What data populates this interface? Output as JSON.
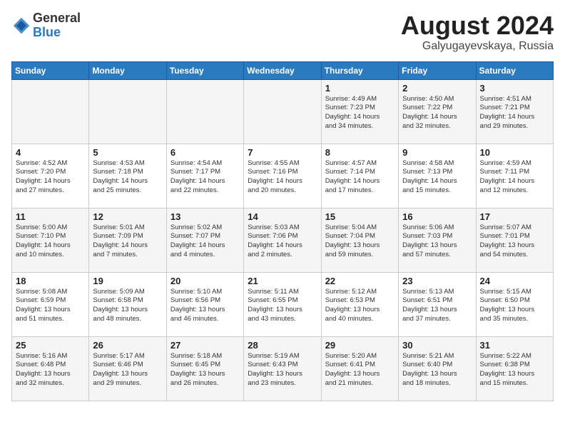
{
  "logo": {
    "general": "General",
    "blue": "Blue"
  },
  "header": {
    "month_year": "August 2024",
    "location": "Galyugayevskaya, Russia"
  },
  "days_of_week": [
    "Sunday",
    "Monday",
    "Tuesday",
    "Wednesday",
    "Thursday",
    "Friday",
    "Saturday"
  ],
  "weeks": [
    [
      {
        "day": "",
        "info": ""
      },
      {
        "day": "",
        "info": ""
      },
      {
        "day": "",
        "info": ""
      },
      {
        "day": "",
        "info": ""
      },
      {
        "day": "1",
        "info": "Sunrise: 4:49 AM\nSunset: 7:23 PM\nDaylight: 14 hours\nand 34 minutes."
      },
      {
        "day": "2",
        "info": "Sunrise: 4:50 AM\nSunset: 7:22 PM\nDaylight: 14 hours\nand 32 minutes."
      },
      {
        "day": "3",
        "info": "Sunrise: 4:51 AM\nSunset: 7:21 PM\nDaylight: 14 hours\nand 29 minutes."
      }
    ],
    [
      {
        "day": "4",
        "info": "Sunrise: 4:52 AM\nSunset: 7:20 PM\nDaylight: 14 hours\nand 27 minutes."
      },
      {
        "day": "5",
        "info": "Sunrise: 4:53 AM\nSunset: 7:18 PM\nDaylight: 14 hours\nand 25 minutes."
      },
      {
        "day": "6",
        "info": "Sunrise: 4:54 AM\nSunset: 7:17 PM\nDaylight: 14 hours\nand 22 minutes."
      },
      {
        "day": "7",
        "info": "Sunrise: 4:55 AM\nSunset: 7:16 PM\nDaylight: 14 hours\nand 20 minutes."
      },
      {
        "day": "8",
        "info": "Sunrise: 4:57 AM\nSunset: 7:14 PM\nDaylight: 14 hours\nand 17 minutes."
      },
      {
        "day": "9",
        "info": "Sunrise: 4:58 AM\nSunset: 7:13 PM\nDaylight: 14 hours\nand 15 minutes."
      },
      {
        "day": "10",
        "info": "Sunrise: 4:59 AM\nSunset: 7:11 PM\nDaylight: 14 hours\nand 12 minutes."
      }
    ],
    [
      {
        "day": "11",
        "info": "Sunrise: 5:00 AM\nSunset: 7:10 PM\nDaylight: 14 hours\nand 10 minutes."
      },
      {
        "day": "12",
        "info": "Sunrise: 5:01 AM\nSunset: 7:09 PM\nDaylight: 14 hours\nand 7 minutes."
      },
      {
        "day": "13",
        "info": "Sunrise: 5:02 AM\nSunset: 7:07 PM\nDaylight: 14 hours\nand 4 minutes."
      },
      {
        "day": "14",
        "info": "Sunrise: 5:03 AM\nSunset: 7:06 PM\nDaylight: 14 hours\nand 2 minutes."
      },
      {
        "day": "15",
        "info": "Sunrise: 5:04 AM\nSunset: 7:04 PM\nDaylight: 13 hours\nand 59 minutes."
      },
      {
        "day": "16",
        "info": "Sunrise: 5:06 AM\nSunset: 7:03 PM\nDaylight: 13 hours\nand 57 minutes."
      },
      {
        "day": "17",
        "info": "Sunrise: 5:07 AM\nSunset: 7:01 PM\nDaylight: 13 hours\nand 54 minutes."
      }
    ],
    [
      {
        "day": "18",
        "info": "Sunrise: 5:08 AM\nSunset: 6:59 PM\nDaylight: 13 hours\nand 51 minutes."
      },
      {
        "day": "19",
        "info": "Sunrise: 5:09 AM\nSunset: 6:58 PM\nDaylight: 13 hours\nand 48 minutes."
      },
      {
        "day": "20",
        "info": "Sunrise: 5:10 AM\nSunset: 6:56 PM\nDaylight: 13 hours\nand 46 minutes."
      },
      {
        "day": "21",
        "info": "Sunrise: 5:11 AM\nSunset: 6:55 PM\nDaylight: 13 hours\nand 43 minutes."
      },
      {
        "day": "22",
        "info": "Sunrise: 5:12 AM\nSunset: 6:53 PM\nDaylight: 13 hours\nand 40 minutes."
      },
      {
        "day": "23",
        "info": "Sunrise: 5:13 AM\nSunset: 6:51 PM\nDaylight: 13 hours\nand 37 minutes."
      },
      {
        "day": "24",
        "info": "Sunrise: 5:15 AM\nSunset: 6:50 PM\nDaylight: 13 hours\nand 35 minutes."
      }
    ],
    [
      {
        "day": "25",
        "info": "Sunrise: 5:16 AM\nSunset: 6:48 PM\nDaylight: 13 hours\nand 32 minutes."
      },
      {
        "day": "26",
        "info": "Sunrise: 5:17 AM\nSunset: 6:46 PM\nDaylight: 13 hours\nand 29 minutes."
      },
      {
        "day": "27",
        "info": "Sunrise: 5:18 AM\nSunset: 6:45 PM\nDaylight: 13 hours\nand 26 minutes."
      },
      {
        "day": "28",
        "info": "Sunrise: 5:19 AM\nSunset: 6:43 PM\nDaylight: 13 hours\nand 23 minutes."
      },
      {
        "day": "29",
        "info": "Sunrise: 5:20 AM\nSunset: 6:41 PM\nDaylight: 13 hours\nand 21 minutes."
      },
      {
        "day": "30",
        "info": "Sunrise: 5:21 AM\nSunset: 6:40 PM\nDaylight: 13 hours\nand 18 minutes."
      },
      {
        "day": "31",
        "info": "Sunrise: 5:22 AM\nSunset: 6:38 PM\nDaylight: 13 hours\nand 15 minutes."
      }
    ]
  ]
}
